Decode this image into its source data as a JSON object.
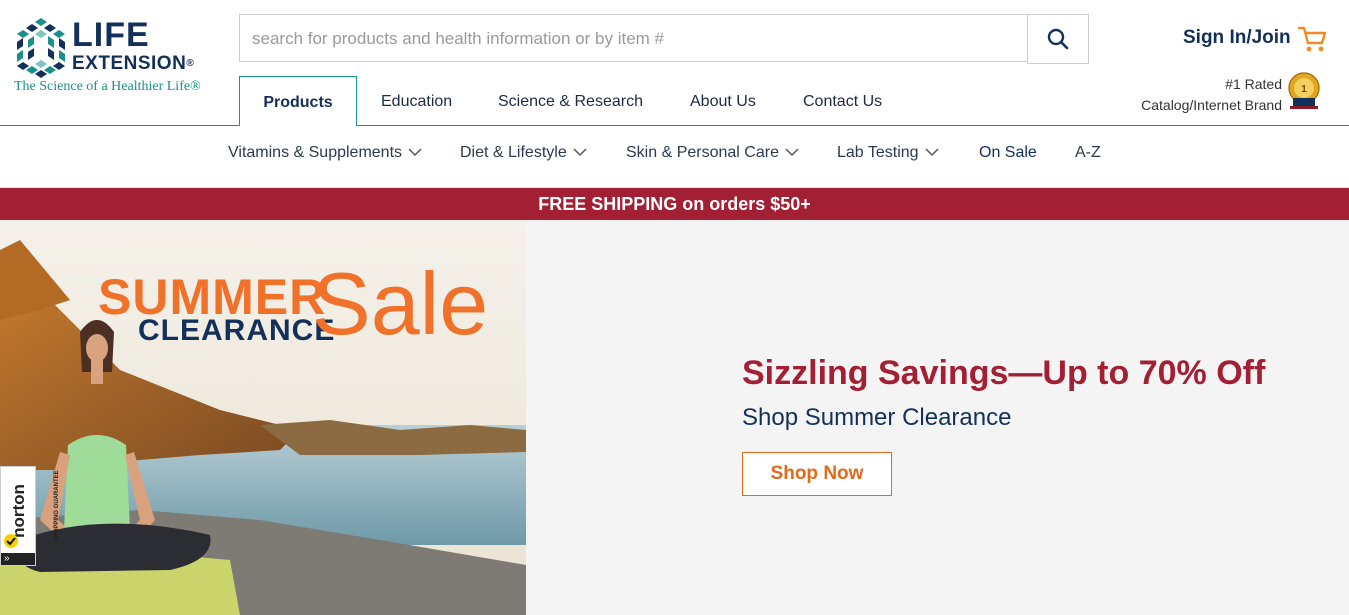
{
  "brand": {
    "name_line1": "LIFE",
    "name_line2": "EXTENSION",
    "registered": "®",
    "tagline": "The Science of a Healthier Life®"
  },
  "search": {
    "placeholder": "search for products and health information or by item #"
  },
  "account": {
    "signin_label": "Sign In/Join"
  },
  "rating": {
    "line1": "#1 Rated",
    "line2": "Catalog/Internet Brand"
  },
  "tabs": [
    {
      "label": "Products",
      "active": true
    },
    {
      "label": "Education"
    },
    {
      "label": "Science & Research"
    },
    {
      "label": "About Us"
    },
    {
      "label": "Contact Us"
    }
  ],
  "subnav": [
    {
      "label": "Vitamins & Supplements",
      "has_dropdown": true
    },
    {
      "label": "Diet & Lifestyle",
      "has_dropdown": true
    },
    {
      "label": "Skin & Personal Care",
      "has_dropdown": true
    },
    {
      "label": "Lab Testing",
      "has_dropdown": true
    },
    {
      "label": "On Sale",
      "has_dropdown": false
    },
    {
      "label": "A-Z",
      "has_dropdown": false
    }
  ],
  "promo_bar": {
    "text": "FREE SHIPPING on orders $50+"
  },
  "hero": {
    "image_text": {
      "summer": "SUMMER",
      "clearance": "CLEARANCE",
      "sale": "Sale"
    },
    "headline": "Sizzling Savings—Up to 70% Off",
    "subhead": "Shop Summer Clearance",
    "cta_label": "Shop Now"
  },
  "norton": {
    "brand": "norton",
    "sub": "SHOPPING GUARANTEE",
    "arrow": "»"
  },
  "colors": {
    "navy": "#12305a",
    "teal": "#1a8f8c",
    "crimson": "#a31f34",
    "orange": "#e36a1b"
  }
}
